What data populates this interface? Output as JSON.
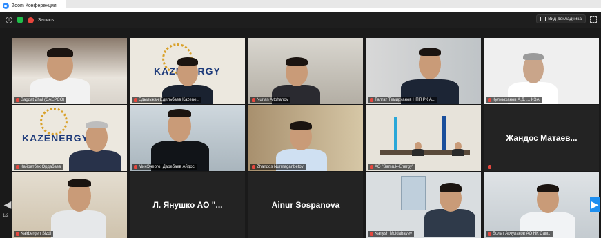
{
  "window": {
    "title": "Zoom Конференция"
  },
  "toolbar": {
    "record_label": "Запись",
    "view_label": "Вид докладчика"
  },
  "pagination": {
    "left_page": "1/2",
    "right_page": "1/2"
  },
  "colors": {
    "accent": "#2d8cff",
    "active_speaker": "#7bd55e",
    "mic_muted": "#e5483f",
    "background": "#1a1a1a"
  },
  "participants": [
    {
      "name": "Bagdat Zhal (CAEPCO)",
      "video": true
    },
    {
      "name": "Едыльжан Едильбаев Kazene...",
      "video": true
    },
    {
      "name": "Nurlan Altbhanov",
      "video": true
    },
    {
      "name": "Талгат Темирханов НПП РК А...",
      "video": true
    },
    {
      "name": "Кулмыханов А.Д. ... КЭА",
      "video": true
    },
    {
      "name": "Кайратбек Ордабаев",
      "video": true
    },
    {
      "name": "МинЭнерго. Даребаев Айдос",
      "video": true
    },
    {
      "name": "Zhandos Nurmaganbetov",
      "video": true
    },
    {
      "name": "АО \"Samruk-Energy\"",
      "video": true
    },
    {
      "name": "Жандос Матаев...",
      "video": false
    },
    {
      "name": "Kairbergen Sizdi",
      "video": true
    },
    {
      "name": "Л. Янушко АО \"...",
      "video": false
    },
    {
      "name": "Ainur Sospanova",
      "video": false
    },
    {
      "name": "Kanysh Moldabayev",
      "video": true
    },
    {
      "name": "Болат Акчулаков АО НК Сам...",
      "video": true
    }
  ],
  "logos": {
    "kazenergy": "KAZENERGY"
  }
}
